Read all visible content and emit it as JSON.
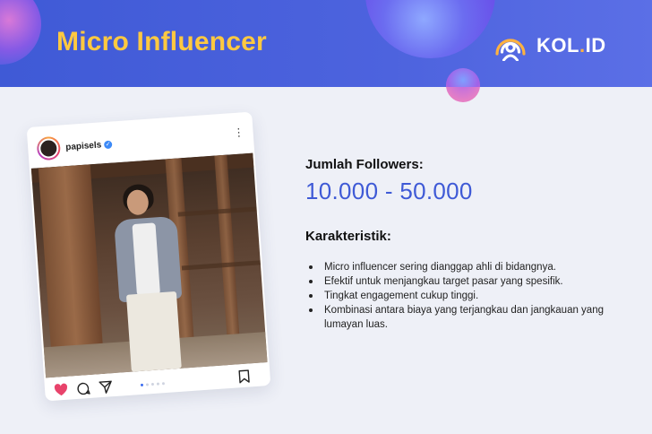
{
  "header": {
    "title": "Micro Influencer",
    "logo_text_main": "KOL",
    "logo_text_dot": ".",
    "logo_text_end": "ID",
    "background": "#4b62dc",
    "title_color": "#ffc940"
  },
  "post": {
    "username": "papisels",
    "verified": true,
    "more_icon": "more-vertical-icon",
    "icons": [
      "heart-icon",
      "comment-icon",
      "share-icon",
      "bookmark-icon"
    ],
    "carousel_dots": 5,
    "like_color": "#e8436b"
  },
  "info": {
    "followers_label": "Jumlah Followers:",
    "followers_value": "10.000 - 50.000",
    "characteristics_label": "Karakteristik:",
    "characteristics": [
      "Micro influencer sering dianggap ahli di bidangnya.",
      "Efektif untuk menjangkau target pasar yang spesifik.",
      "Tingkat engagement cukup tinggi.",
      "Kombinasi antara biaya yang terjangkau dan jangkauan yang lumayan luas."
    ],
    "accent_color": "#3f5ad6"
  }
}
